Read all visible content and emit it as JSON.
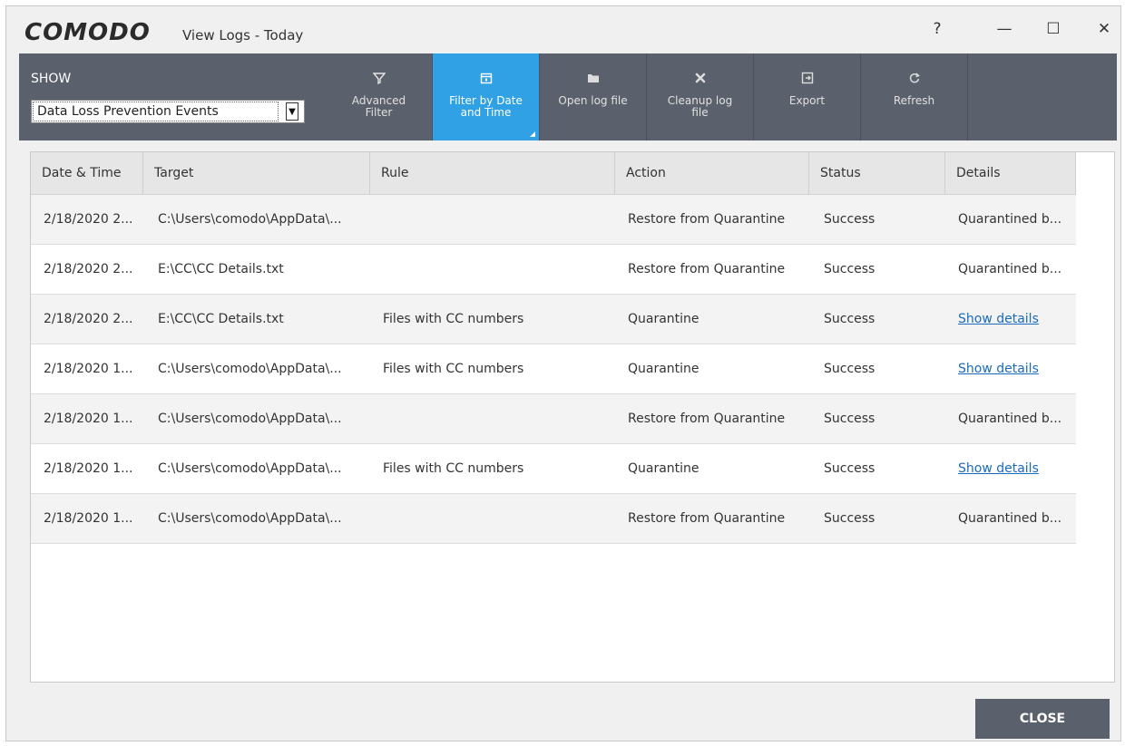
{
  "window": {
    "brand": "COMODO",
    "title": "View Logs - Today",
    "help": "?",
    "minimize": "—",
    "maximize": "☐",
    "close": "✕"
  },
  "toolbar": {
    "show_label": "SHOW",
    "show_value": "Data Loss Prevention Events",
    "buttons": [
      {
        "label": "Advanced\nFilter",
        "icon": "filter-icon"
      },
      {
        "label": "Filter by Date\nand Time",
        "icon": "calendar-icon"
      },
      {
        "label": "Open log file",
        "icon": "folder-icon"
      },
      {
        "label": "Cleanup log\nfile",
        "icon": "cleanup-icon"
      },
      {
        "label": "Export",
        "icon": "export-icon"
      },
      {
        "label": "Refresh",
        "icon": "refresh-icon"
      }
    ]
  },
  "table": {
    "columns": [
      "Date & Time",
      "Target",
      "Rule",
      "Action",
      "Status",
      "Details"
    ],
    "rows": [
      {
        "datetime": "2/18/2020 2...",
        "target": "C:\\Users\\comodo\\AppData\\...",
        "rule": "",
        "action": "Restore from Quarantine",
        "status": "Success",
        "details": "Quarantined b..."
      },
      {
        "datetime": "2/18/2020 2...",
        "target": "E:\\CC\\CC Details.txt",
        "rule": "",
        "action": "Restore from Quarantine",
        "status": "Success",
        "details": "Quarantined b..."
      },
      {
        "datetime": "2/18/2020 2...",
        "target": "E:\\CC\\CC Details.txt",
        "rule": "Files with CC numbers",
        "action": "Quarantine",
        "status": "Success",
        "details": "Show details"
      },
      {
        "datetime": "2/18/2020 1...",
        "target": "C:\\Users\\comodo\\AppData\\...",
        "rule": "Files with CC numbers",
        "action": "Quarantine",
        "status": "Success",
        "details": "Show details"
      },
      {
        "datetime": "2/18/2020 1...",
        "target": "C:\\Users\\comodo\\AppData\\...",
        "rule": "",
        "action": "Restore from Quarantine",
        "status": "Success",
        "details": "Quarantined b..."
      },
      {
        "datetime": "2/18/2020 1...",
        "target": "C:\\Users\\comodo\\AppData\\...",
        "rule": "Files with CC numbers",
        "action": "Quarantine",
        "status": "Success",
        "details": "Show details"
      },
      {
        "datetime": "2/18/2020 1...",
        "target": "C:\\Users\\comodo\\AppData\\...",
        "rule": "",
        "action": "Restore from Quarantine",
        "status": "Success",
        "details": "Quarantined b..."
      }
    ]
  },
  "footer": {
    "close_label": "CLOSE"
  },
  "colors": {
    "toolbar_bg": "#5b616c",
    "active_button": "#2fa1e4",
    "link": "#1a6bbd"
  }
}
